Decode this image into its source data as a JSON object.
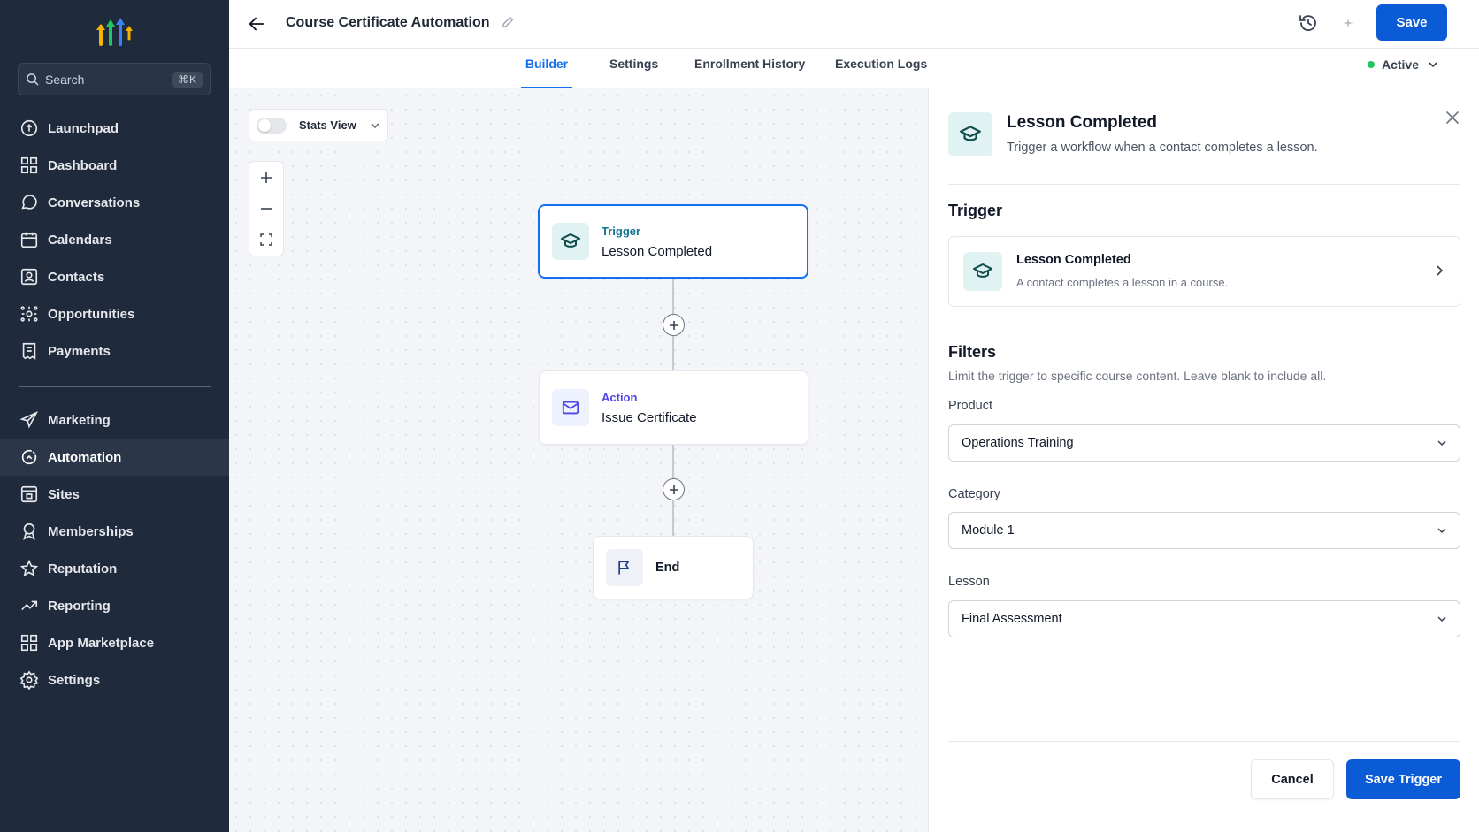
{
  "sidebar": {
    "search": {
      "placeholder": "Search",
      "shortcut": "⌘K"
    },
    "items": [
      {
        "label": "Launchpad",
        "icon": "launchpad-icon"
      },
      {
        "label": "Dashboard",
        "icon": "dashboard-icon"
      },
      {
        "label": "Conversations",
        "icon": "chat-bubble-icon"
      },
      {
        "label": "Calendars",
        "icon": "calendar-icon"
      },
      {
        "label": "Contacts",
        "icon": "contact-card-icon"
      },
      {
        "label": "Opportunities",
        "icon": "opportunities-icon"
      },
      {
        "label": "Payments",
        "icon": "receipt-icon"
      },
      {
        "label": "Marketing",
        "icon": "paper-plane-icon"
      },
      {
        "label": "Automation",
        "icon": "automation-icon",
        "active": true
      },
      {
        "label": "Sites",
        "icon": "sites-icon"
      },
      {
        "label": "Memberships",
        "icon": "award-icon"
      },
      {
        "label": "Reputation",
        "icon": "star-icon"
      },
      {
        "label": "Reporting",
        "icon": "trend-line-icon"
      },
      {
        "label": "App Marketplace",
        "icon": "grid-apps-icon"
      },
      {
        "label": "Settings",
        "icon": "gear-icon"
      }
    ]
  },
  "header": {
    "title": "Course Certificate Automation",
    "save_label": "Save"
  },
  "tabs": [
    {
      "label": "Builder",
      "active": true
    },
    {
      "label": "Settings"
    },
    {
      "label": "Enrollment History"
    },
    {
      "label": "Execution Logs"
    }
  ],
  "status": {
    "label": "Active",
    "color": "#22c55e"
  },
  "canvas": {
    "stats_label": "Stats View",
    "stats_enabled": false,
    "nodes": [
      {
        "kind": "Trigger",
        "name": "Lesson Completed",
        "icon": "graduation-cap-icon"
      },
      {
        "kind": "Action",
        "name": "Issue Certificate",
        "icon": "envelope-icon"
      },
      {
        "kind": "",
        "name": "End",
        "icon": "flag-icon"
      }
    ]
  },
  "panel": {
    "title": "Lesson Completed",
    "subtitle": "Trigger a workflow when a contact completes a lesson.",
    "trigger_section": "Trigger",
    "trigger_card": {
      "title": "Lesson Completed",
      "description": "A contact completes a lesson in a course."
    },
    "filters_section": "Filters",
    "filters_description": "Limit the trigger to specific course content. Leave blank to include all.",
    "fields": [
      {
        "label": "Product",
        "value": "Operations Training"
      },
      {
        "label": "Category",
        "value": "Module 1"
      },
      {
        "label": "Lesson",
        "value": "Final Assessment"
      }
    ],
    "cancel_label": "Cancel",
    "save_label": "Save Trigger"
  },
  "colors": {
    "sidebar_bg": "#1f2a3c",
    "primary": "#0b5bd6",
    "trigger_accent": "#0e7490",
    "action_accent": "#4f46e5"
  }
}
